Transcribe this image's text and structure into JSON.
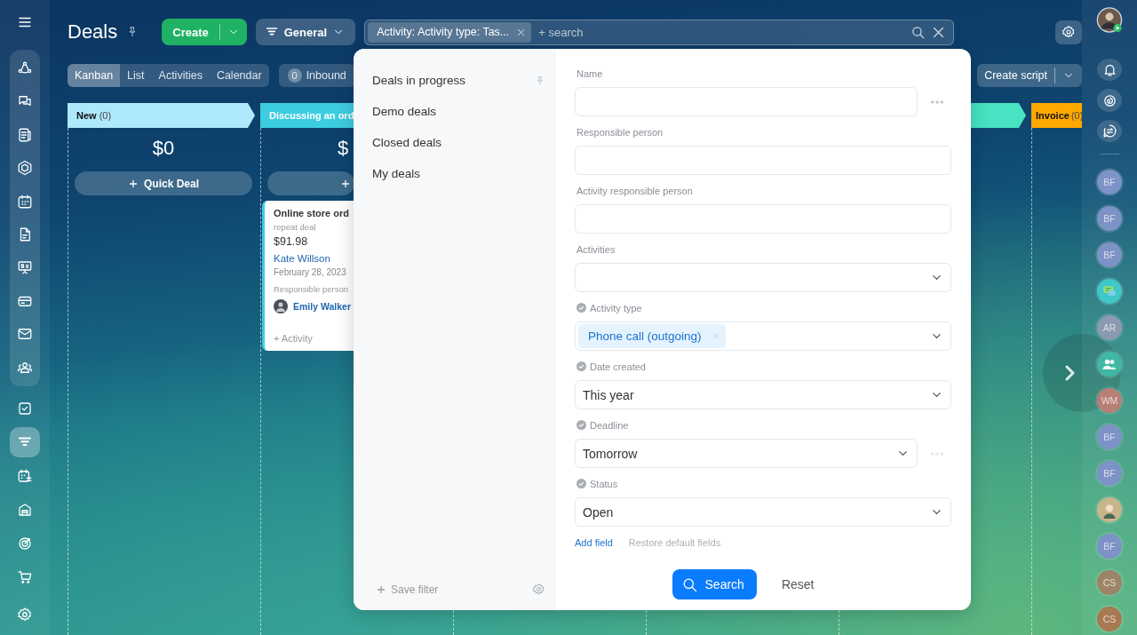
{
  "sidebar": {
    "items": [
      {
        "selected": false
      },
      {
        "selected": false
      },
      {
        "selected": false
      },
      {
        "selected": false
      },
      {
        "selected": false
      },
      {
        "selected": false
      },
      {
        "selected": false
      },
      {
        "selected": false
      },
      {
        "selected": false
      },
      {
        "selected": false
      },
      {
        "selected": false
      },
      {
        "selected": true
      },
      {
        "selected": false
      },
      {
        "selected": false
      },
      {
        "selected": false
      },
      {
        "selected": false
      }
    ]
  },
  "header": {
    "title": "Deals",
    "create": "Create",
    "general": "General",
    "search": {
      "tag": "Activity: Activity type: Tas...",
      "placeholder": "+ search"
    }
  },
  "views": [
    {
      "label": "Kanban",
      "selected": true
    },
    {
      "label": "List",
      "selected": false
    },
    {
      "label": "Activities",
      "selected": false
    },
    {
      "label": "Calendar",
      "selected": false
    }
  ],
  "inbound": {
    "count": "0",
    "label": "Inbound"
  },
  "create_script": "Create script",
  "stages": [
    {
      "kind": "stage",
      "title": "New",
      "count": "(0)",
      "color": "#aee9fb",
      "total": "$0",
      "quick_label": "Quick Deal"
    },
    {
      "kind": "stage",
      "title": "Discussing an ord",
      "color": "#3dcde0",
      "total": "$",
      "card": {
        "title": "Online store ord",
        "subtitle": "repeat deal",
        "amount": "$91.98",
        "contact": "Kate Willson",
        "date": "February 28, 2023",
        "responsible_label": "Responsible person",
        "responsible": "Emily Walker",
        "activity": "+ Activity"
      }
    },
    {
      "kind": "hidden"
    },
    {
      "kind": "hidden"
    },
    {
      "kind": "stage",
      "color": "#47e3c2"
    },
    {
      "kind": "stage",
      "title": "Invoice",
      "count": "(0)",
      "color": "#ffa800"
    }
  ],
  "right_bar": {
    "avatars": [
      {
        "kind": "initials",
        "initials": "BF",
        "color": "#7d92c6"
      },
      {
        "kind": "initials",
        "initials": "BF",
        "color": "#7d92c6"
      },
      {
        "kind": "initials",
        "initials": "BF",
        "color": "#7d92c6"
      },
      {
        "kind": "chat",
        "color": "#3fc7c9"
      },
      {
        "kind": "initials",
        "initials": "AR",
        "color": "#8a9ab0"
      },
      {
        "kind": "group",
        "color": "#3fb9a6"
      },
      {
        "kind": "initials",
        "initials": "WM",
        "color": "#b77f76"
      },
      {
        "kind": "initials",
        "initials": "BF",
        "color": "#7d92c6"
      },
      {
        "kind": "initials",
        "initials": "BF",
        "color": "#7d92c6"
      },
      {
        "kind": "photo",
        "color": "#c9b58a"
      },
      {
        "kind": "initials",
        "initials": "BF",
        "color": "#7d92c6"
      },
      {
        "kind": "initials",
        "initials": "CS",
        "color": "#9c8466"
      },
      {
        "kind": "initials",
        "initials": "CS",
        "color": "#a87a52"
      }
    ]
  },
  "filter": {
    "presets": [
      {
        "label": "Deals in progress",
        "pinned": true
      },
      {
        "label": "Demo deals",
        "pinned": false
      },
      {
        "label": "Closed deals",
        "pinned": false
      },
      {
        "label": "My deals",
        "pinned": false
      }
    ],
    "save_filter": "Save filter",
    "fields": [
      {
        "label": "Name",
        "kind": "text",
        "checked": false,
        "more": true
      },
      {
        "label": "Responsible person",
        "kind": "text",
        "checked": false,
        "more": false
      },
      {
        "label": "Activity responsible person",
        "kind": "text",
        "checked": false,
        "more": false
      },
      {
        "label": "Activities",
        "kind": "select",
        "checked": false,
        "more": false
      },
      {
        "label": "Activity type",
        "kind": "tags",
        "checked": true,
        "more": false,
        "tags": [
          "Phone call (outgoing)"
        ]
      },
      {
        "label": "Date created",
        "kind": "select",
        "value": "This year",
        "checked": true,
        "more": false
      },
      {
        "label": "Deadline",
        "kind": "select",
        "value": "Tomorrow",
        "checked": true,
        "more": true
      },
      {
        "label": "Status",
        "kind": "select",
        "value": "Open",
        "checked": true,
        "more": false
      }
    ],
    "add_field": "Add field",
    "restore": "Restore default fields",
    "search_button": "Search",
    "reset_button": "Reset"
  }
}
